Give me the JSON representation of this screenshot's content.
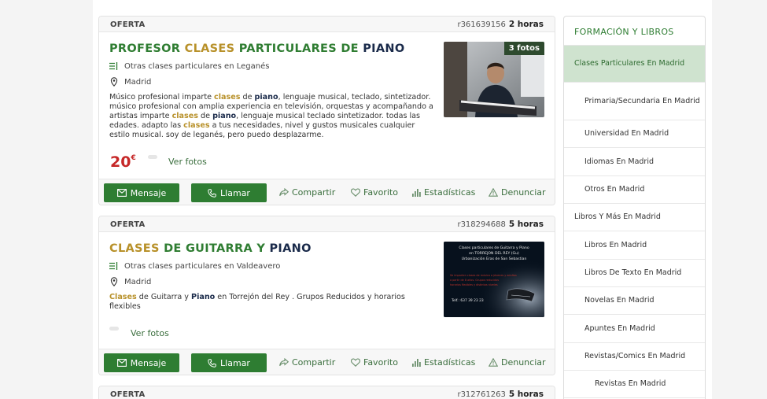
{
  "ads": [
    {
      "type": "OFERTA",
      "ref": "r361639156",
      "time": "2 horas",
      "title": {
        "w1": "PROFESOR",
        "w2": "CLASES",
        "w3": "PARTICULARES DE",
        "w4": "PIANO"
      },
      "category": "Otras clases particulares en Leganés",
      "location": "Madrid",
      "description": {
        "p1": "Músico profesional imparte ",
        "k1": "clases",
        "p2": " de ",
        "k2": "piano",
        "p3": ", lenguaje musical, teclado, sintetizador. músico profesional con amplia experiencia en televisión, orquestas y acompañando a artistas imparte ",
        "k3": "clases",
        "p4": " de ",
        "k4": "piano",
        "p5": ", lenguaje musical teclado sintetizador. todas las edades. adapto las ",
        "k5": "clases",
        "p6": " a tus necesidades, nivel y gustos musicales cualquier estilo musical. soy de leganés, pero puedo desplazarme."
      },
      "price": "20",
      "currency": "€",
      "photos_badge": "3 fotos",
      "see_photos": "Ver fotos"
    },
    {
      "type": "OFERTA",
      "ref": "r318294688",
      "time": "5 horas",
      "title": {
        "w1": "CLASES",
        "w2": "DE",
        "w3": "GUITARRA Y",
        "w4": "PIANO"
      },
      "category": "Otras clases particulares en Valdeavero",
      "location": "Madrid",
      "description": {
        "k1": "Clases",
        "p1": " de Guitarra y ",
        "k2": "Piano",
        "p2": " en Torrejón del Rey . Grupos Reducidos y horarios flexibles"
      },
      "see_photos": "Ver fotos"
    },
    {
      "type": "OFERTA",
      "ref": "r312761263",
      "time": "5 horas"
    }
  ],
  "actions": {
    "message": "Mensaje",
    "call": "Llamar",
    "share": "Compartir",
    "favorite": "Favorito",
    "stats": "Estadísticas",
    "report": "Denunciar"
  },
  "sidebar": {
    "title": "FORMACIÓN Y LIBROS",
    "items": [
      {
        "label": "Clases Particulares En Madrid",
        "active": true
      },
      {
        "label": "Primaria/Secundaria En Madrid"
      },
      {
        "label": "Universidad En Madrid"
      },
      {
        "label": "Idiomas En Madrid"
      },
      {
        "label": "Otros En Madrid"
      },
      {
        "label": "Libros Y Más En Madrid"
      },
      {
        "label": "Libros En Madrid"
      },
      {
        "label": "Libros De Texto En Madrid"
      },
      {
        "label": "Novelas En Madrid"
      },
      {
        "label": "Apuntes En Madrid"
      },
      {
        "label": "Revistas/Comics En Madrid"
      },
      {
        "label": "Revistas En Madrid"
      }
    ]
  },
  "flyer": {
    "line1": "Clases particulares de Guitarra y Piano",
    "line2": "en TORREJON DEL REY (Gu)",
    "line3": "Urbanización Eras de San Sebastian",
    "red1": "Se imparten clases de música a jóvenes y adultos",
    "red2": "a partir de 8 años. Grupos reducidos",
    "red3": "horarios flexibles y distintos niveles",
    "phone": "Telf.: 637 39 23 23"
  },
  "colors": {
    "green": "#2e7d32",
    "gold": "#b8912a",
    "navy": "#1a2a4a",
    "price": "#c62828",
    "sidebar_active": "#cfe3cf"
  }
}
